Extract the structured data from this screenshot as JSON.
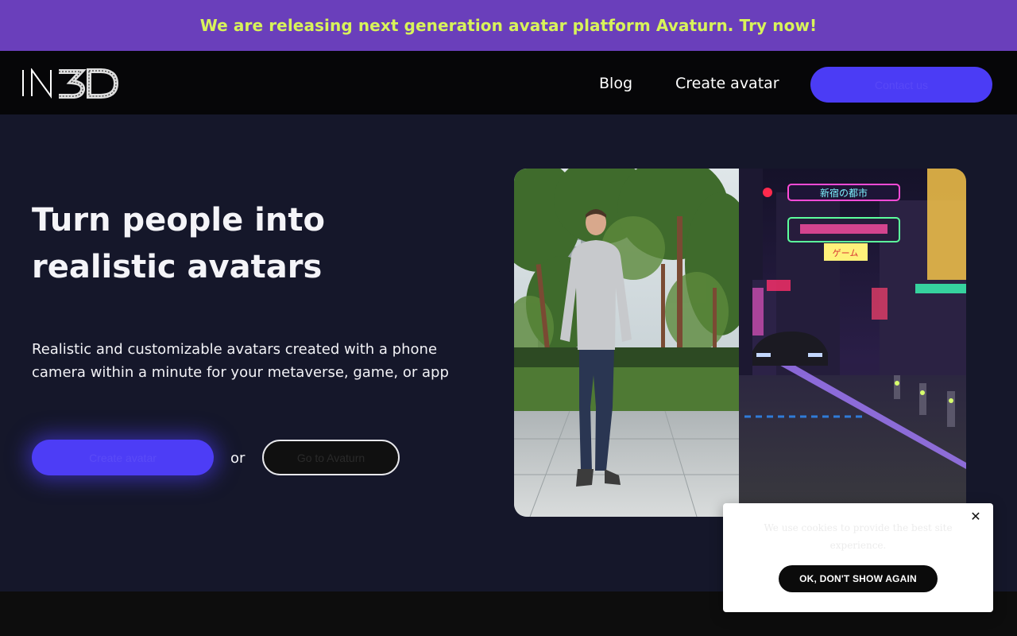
{
  "announcement": {
    "text": "We are releasing next generation avatar platform Avaturn. Try now!"
  },
  "header": {
    "logo_text": "IN3D",
    "nav": [
      {
        "label": "Blog"
      },
      {
        "label": "Create avatar"
      }
    ],
    "cta_label": "Contact us"
  },
  "hero": {
    "title": "Turn people into realistic avatars",
    "subtitle": "Realistic and customizable avatars created with a phone camera within a minute for your metaverse, game, or app",
    "primary_cta": "Create avatar",
    "or_text": "or",
    "secondary_cta": "Go to Avaturn",
    "media_sign_1": "新宿の都市",
    "media_sign_2": "ゲーム"
  },
  "cookie_banner": {
    "text": "We use cookies to provide the best site experience.",
    "accept_label": "OK, DON'T SHOW AGAIN",
    "close_glyph": "✕"
  },
  "colors": {
    "announcement_bg": "#6a3fbb",
    "announcement_text": "#d8f35a",
    "accent": "#4b3cf5",
    "page_bg": "#15172a",
    "header_bg": "#060608"
  },
  "icons": {
    "close": "close-icon",
    "logo": "in3d-logo-icon"
  }
}
